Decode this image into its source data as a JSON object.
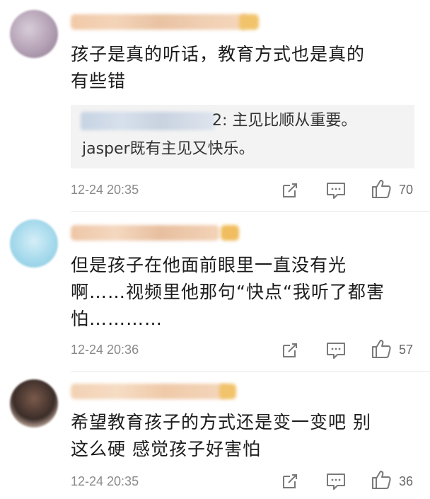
{
  "comments": [
    {
      "text_lines": [
        "孩子是真的听话，教育方式也是真的",
        "有些错"
      ],
      "reply": {
        "name_suffix": "2: 主见比顺从重要。",
        "line2": "jasper既有主见又快乐。"
      },
      "time": "12-24 20:35",
      "likes": "70"
    },
    {
      "text_lines": [
        "但是孩子在他面前眼里一直没有光",
        "啊……视频里他那句“快点“我听了都害",
        "怕…………"
      ],
      "time": "12-24 20:36",
      "likes": "57"
    },
    {
      "text_lines": [
        "希望教育孩子的方式还是变一变吧 别",
        "这么硬 感觉孩子好害怕"
      ],
      "time": "12-24 20:35",
      "likes": "36"
    }
  ],
  "icons": {
    "share": "share-icon",
    "comment": "comment-icon",
    "like": "thumbs-up-icon"
  }
}
